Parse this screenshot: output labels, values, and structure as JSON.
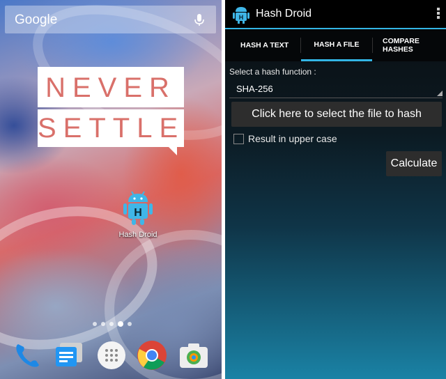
{
  "home": {
    "search_label": "Google",
    "wallpaper_line1": "NEVER",
    "wallpaper_line2": "SETTLE",
    "app_icon_label": "Hash Droid",
    "page_count": 5,
    "current_page": 4,
    "dock": [
      "phone-icon",
      "messages-icon",
      "app-drawer-icon",
      "chrome-icon",
      "camera-icon"
    ]
  },
  "app": {
    "title": "Hash Droid",
    "accent_color": "#33b5e5",
    "tabs": [
      {
        "label": "HASH A TEXT",
        "selected": false
      },
      {
        "label": "HASH A FILE",
        "selected": true
      },
      {
        "label": "COMPARE HASHES",
        "selected": false
      }
    ],
    "hash_function_label": "Select a hash function :",
    "hash_function_value": "SHA-256",
    "select_file_button": "Click here to select the file to hash",
    "uppercase_label": "Result in upper case",
    "uppercase_checked": false,
    "calculate_button": "Calculate"
  }
}
